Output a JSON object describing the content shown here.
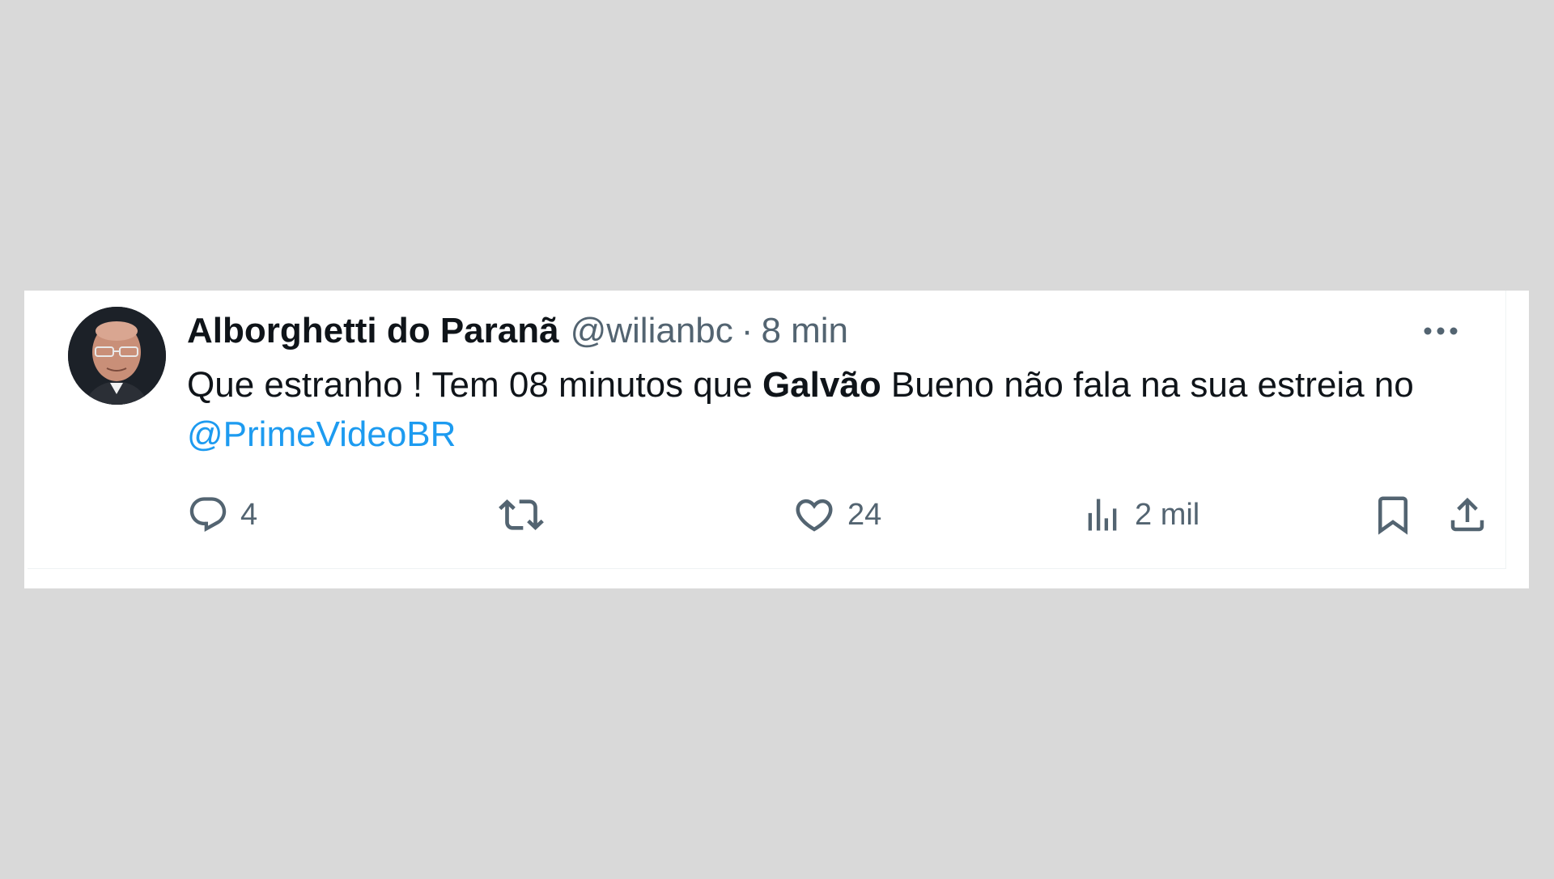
{
  "tweet": {
    "display_name": "Alborghetti do Paranã",
    "handle": "@wilianbc",
    "separator": "·",
    "time": "8 min",
    "text_part1": "Que estranho ! Tem 08 minutos que ",
    "text_bold": "Galvão",
    "text_part2": " Bueno não fala na sua estreia no ",
    "mention": "@PrimeVideoBR",
    "mention_color": "#1d9bf0"
  },
  "actions": {
    "reply_count": "4",
    "retweet_count": "",
    "like_count": "24",
    "views_count": "2 mil"
  },
  "icons": [
    "avatar",
    "more-icon",
    "reply-icon",
    "retweet-icon",
    "like-icon",
    "views-icon",
    "bookmark-icon",
    "share-icon"
  ],
  "colors": {
    "background": "#d9d9d9",
    "text": "#0f1419",
    "secondary": "#536471"
  }
}
